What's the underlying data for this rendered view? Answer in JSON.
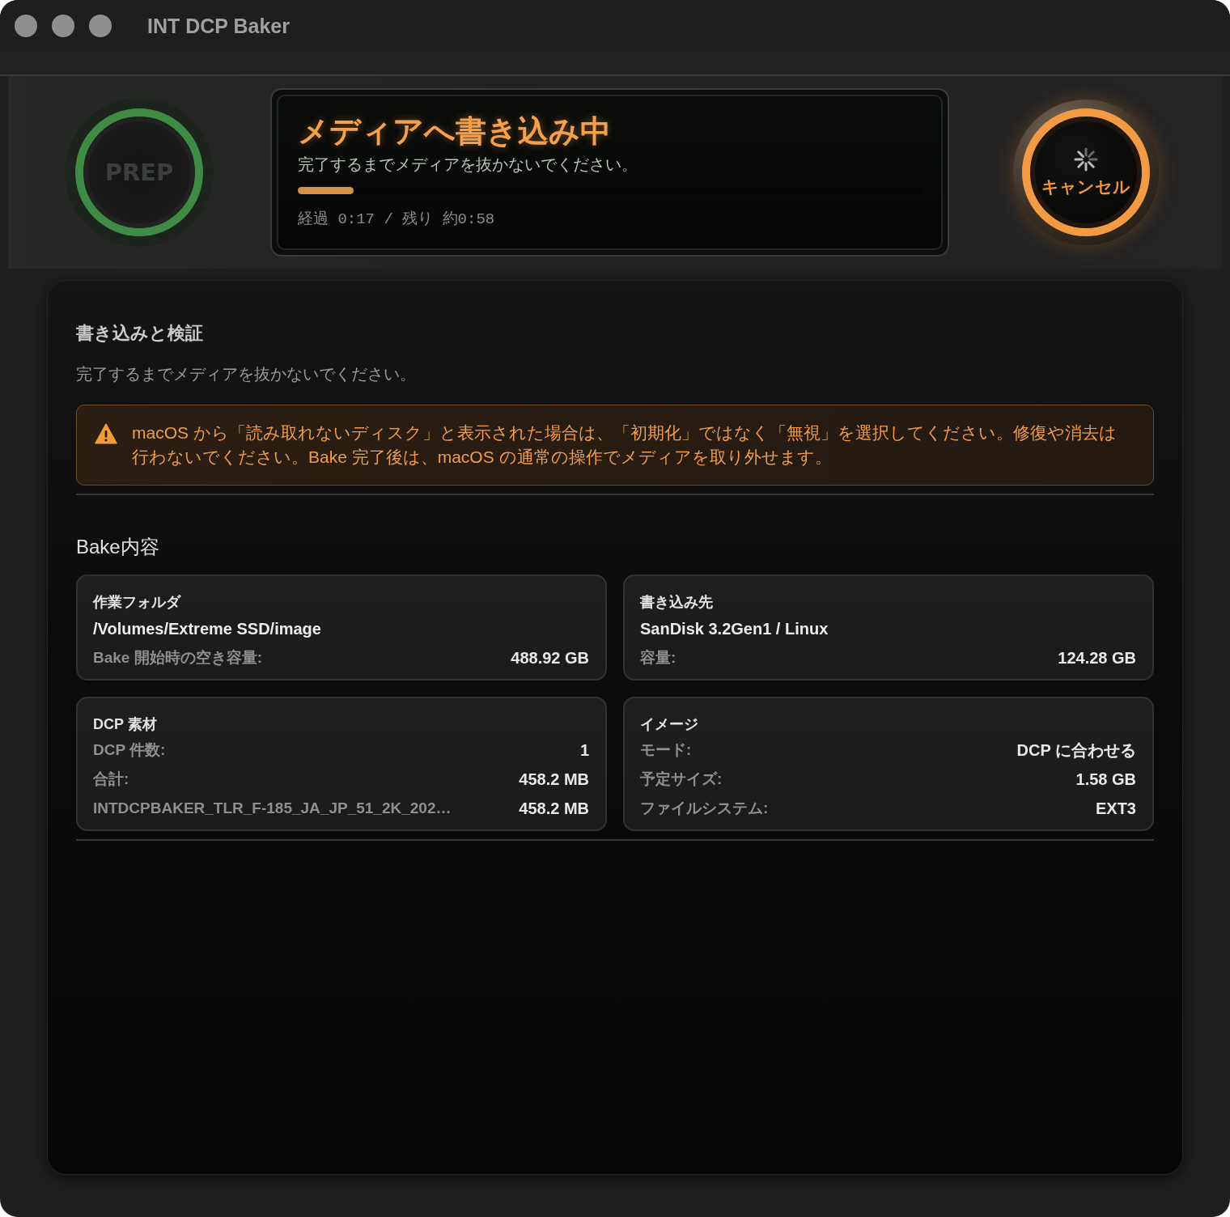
{
  "window": {
    "title": "INT DCP Baker"
  },
  "stage_button": {
    "label": "PREP"
  },
  "status": {
    "title": "メディアへ書き込み中",
    "message": "完了するまでメディアを抜かないでください。",
    "progress": {
      "level": 0.09
    },
    "timing": "経過 0:17 / 残り 約0:58"
  },
  "cancel_button": {
    "label": "キャンセル",
    "busy": true
  },
  "panel": {
    "title": "書き込みと検証",
    "message": "完了するまでメディアを抜かないでください。",
    "warning": {
      "text": "macOS から「読み取れないディスク」と表示された場合は、「初期化」ではなく「無視」を選択してください。修復や消去は行わないでください。Bake 完了後は、macOS の通常の操作でメディアを取り外せます。"
    },
    "section_title": "Bake内容",
    "cards": [
      {
        "title": "作業フォルダ",
        "path": "/Volumes/Extreme SSD/image",
        "rows": [
          {
            "label": "Bake 開始時の空き容量:",
            "value": "488.92 GB"
          }
        ]
      },
      {
        "title": "書き込み先",
        "path": "SanDisk 3.2Gen1 / Linux",
        "rows": [
          {
            "label": "容量:",
            "value": "124.28 GB"
          }
        ]
      },
      {
        "title": "DCP 素材",
        "rows": [
          {
            "label": "DCP 件数:",
            "value": "1"
          },
          {
            "label": "合計:",
            "value": "458.2 MB"
          },
          {
            "label": "INTDCPBAKER_TLR_F-185_JA_JP_51_2K_202…",
            "value": "458.2 MB"
          }
        ]
      },
      {
        "title": "イメージ",
        "rows": [
          {
            "label": "モード:",
            "value": "DCP に合わせる"
          },
          {
            "label": "予定サイズ:",
            "value": "1.58 GB"
          },
          {
            "label": "ファイルシステム:",
            "value": "EXT3"
          }
        ]
      }
    ]
  }
}
